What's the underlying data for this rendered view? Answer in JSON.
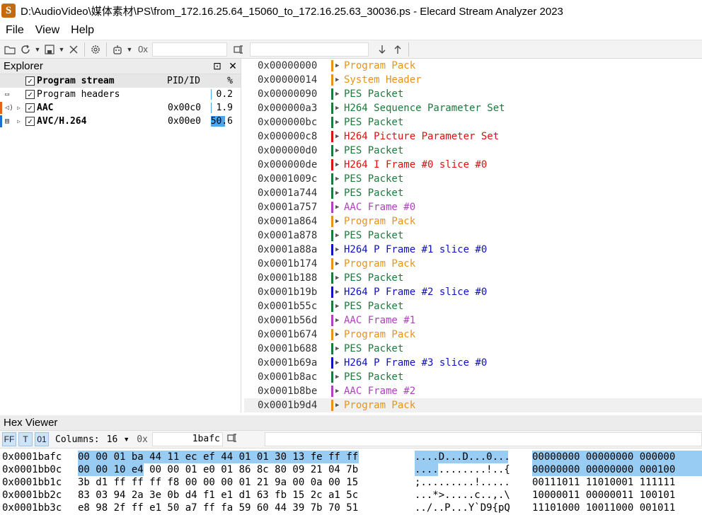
{
  "window": {
    "icon_letter": "S",
    "title": "D:\\AudioVideo\\媒体素材\\PS\\from_172.16.25.64_15060_to_172.16.25.63_30036.ps - Elecard Stream Analyzer 2023"
  },
  "menu": [
    "File",
    "View",
    "Help"
  ],
  "toolbar": {
    "hex_prefix": "0x",
    "goto_value": "",
    "search_value": ""
  },
  "explorer": {
    "title": "Explorer",
    "pin_glyph": "⊡",
    "close_glyph": "✕",
    "columns": {
      "name": "Program stream",
      "pid": "PID/ID",
      "pct": "%"
    },
    "rows": [
      {
        "name": "Program headers",
        "pid": "",
        "pct": "0.2",
        "bold": false,
        "color": "",
        "pct_fill": 0.002
      },
      {
        "name": "AAC",
        "pid": "0x00c0",
        "pct": "1.9",
        "bold": true,
        "color": "#e8621c",
        "pct_fill": 0.019
      },
      {
        "name": "AVC/H.264",
        "pid": "0x00e0",
        "pct": "50.6",
        "bold": true,
        "color": "#1a6fd1",
        "pct_fill": 0.506
      }
    ]
  },
  "packets": [
    {
      "addr": "0x00000000",
      "name": "Program Pack",
      "color": "#e8921c"
    },
    {
      "addr": "0x00000014",
      "name": "System Header",
      "color": "#e8921c"
    },
    {
      "addr": "0x00000090",
      "name": "PES Packet",
      "color": "#1c7a3c"
    },
    {
      "addr": "0x000000a3",
      "name": "H264 Sequence Parameter Set",
      "color": "#1c7a3c"
    },
    {
      "addr": "0x000000bc",
      "name": "PES Packet",
      "color": "#1c7a3c"
    },
    {
      "addr": "0x000000c8",
      "name": "H264 Picture Parameter Set",
      "color": "#e01010"
    },
    {
      "addr": "0x000000d0",
      "name": "PES Packet",
      "color": "#1c7a3c"
    },
    {
      "addr": "0x000000de",
      "name": "H264 I Frame #0 slice #0",
      "color": "#e01010"
    },
    {
      "addr": "0x0001009c",
      "name": "PES Packet",
      "color": "#1c7a3c"
    },
    {
      "addr": "0x0001a744",
      "name": "PES Packet",
      "color": "#1c7a3c"
    },
    {
      "addr": "0x0001a757",
      "name": "AAC Frame #0",
      "color": "#b040c0"
    },
    {
      "addr": "0x0001a864",
      "name": "Program Pack",
      "color": "#e8921c"
    },
    {
      "addr": "0x0001a878",
      "name": "PES Packet",
      "color": "#1c7a3c"
    },
    {
      "addr": "0x0001a88a",
      "name": "H264 P Frame #1 slice #0",
      "color": "#1010c0"
    },
    {
      "addr": "0x0001b174",
      "name": "Program Pack",
      "color": "#e8921c"
    },
    {
      "addr": "0x0001b188",
      "name": "PES Packet",
      "color": "#1c7a3c"
    },
    {
      "addr": "0x0001b19b",
      "name": "H264 P Frame #2 slice #0",
      "color": "#1010c0"
    },
    {
      "addr": "0x0001b55c",
      "name": "PES Packet",
      "color": "#1c7a3c"
    },
    {
      "addr": "0x0001b56d",
      "name": "AAC Frame #1",
      "color": "#b040c0"
    },
    {
      "addr": "0x0001b674",
      "name": "Program Pack",
      "color": "#e8921c"
    },
    {
      "addr": "0x0001b688",
      "name": "PES Packet",
      "color": "#1c7a3c"
    },
    {
      "addr": "0x0001b69a",
      "name": "H264 P Frame #3 slice #0",
      "color": "#1010c0"
    },
    {
      "addr": "0x0001b8ac",
      "name": "PES Packet",
      "color": "#1c7a3c"
    },
    {
      "addr": "0x0001b8be",
      "name": "AAC Frame #2",
      "color": "#b040c0"
    },
    {
      "addr": "0x0001b9d4",
      "name": "Program Pack",
      "color": "#e8921c"
    }
  ],
  "hex": {
    "title": "Hex Viewer",
    "mode_buttons": [
      "FF",
      "T",
      "01"
    ],
    "columns_label": "Columns:",
    "columns_value": "16",
    "prefix": "0x",
    "offset_value": "1bafc",
    "rows": [
      {
        "addr": "0x0001bafc",
        "bytes": "00 00 01 ba 44 11 ec ef 44 01 01 30 13 fe ff ff",
        "ascii": "....D...D...0...",
        "bits": "00000000 00000000 000000",
        "hl_bytes": 16
      },
      {
        "addr": "0x0001bb0c",
        "bytes": "00 00 10 e4 00 00 01 e0 01 86 8c 80 09 21 04 7b",
        "ascii": "............!..{",
        "bits": "00000000 00000000 000100",
        "hl_bytes": 4
      },
      {
        "addr": "0x0001bb1c",
        "bytes": "3b d1 ff ff ff f8 00 00 00 01 21 9a 00 0a 00 15",
        "ascii": ";.........!.....",
        "bits": "00111011 11010001 111111",
        "hl_bytes": 0
      },
      {
        "addr": "0x0001bb2c",
        "bytes": "83 03 94 2a 3e 0b d4 f1 e1 d1 63 fb 15 2c a1 5c",
        "ascii": "...*>.....c..,.\\",
        "bits": "10000011 00000011 100101",
        "hl_bytes": 0
      },
      {
        "addr": "0x0001bb3c",
        "bytes": "e8 98 2f ff e1 50 a7 ff fa 59 60 44 39 7b 70 51",
        "ascii": "../..P...Y`D9{pQ",
        "bits": "11101000 10011000 001011",
        "hl_bytes": 0
      }
    ]
  }
}
